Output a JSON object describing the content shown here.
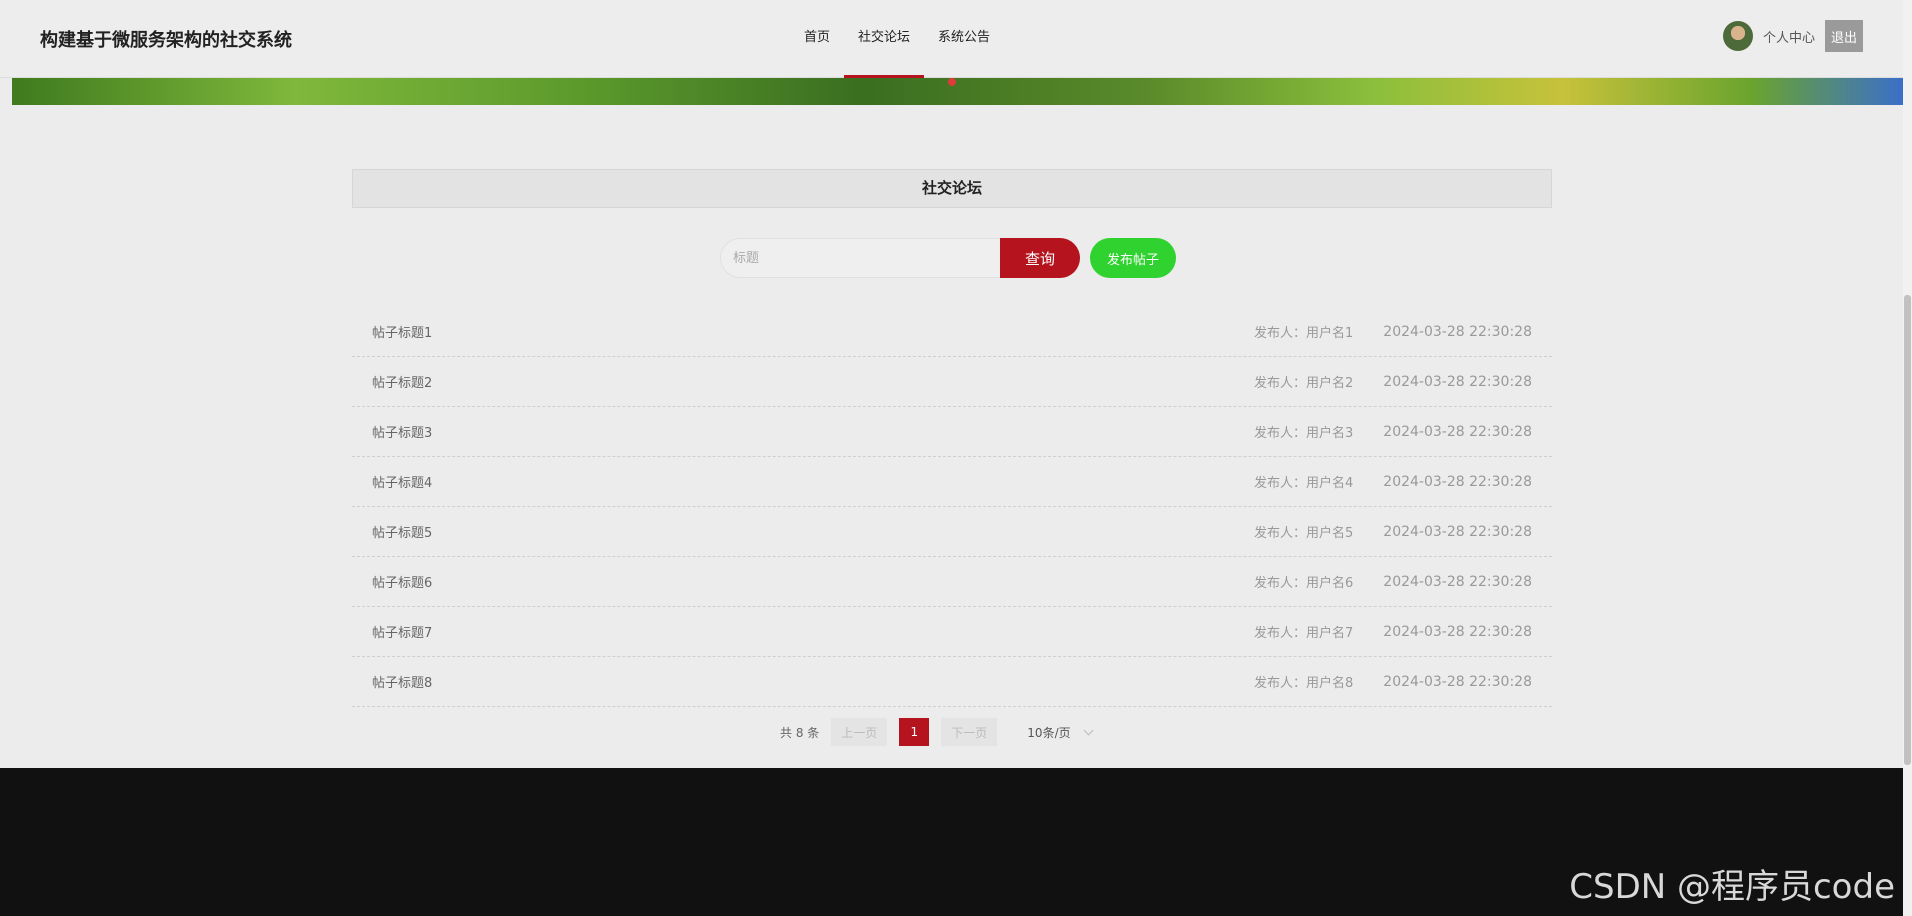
{
  "header": {
    "site_title": "构建基于微服务架构的社交系统",
    "nav": [
      {
        "label": "首页",
        "active": false
      },
      {
        "label": "社交论坛",
        "active": true
      },
      {
        "label": "系统公告",
        "active": false
      }
    ],
    "user_center": "个人中心",
    "logout": "退出"
  },
  "forum": {
    "title": "社交论坛",
    "search_placeholder": "标题",
    "search_button": "查询",
    "publish_button": "发布帖子",
    "posts": [
      {
        "title": "帖子标题1",
        "author": "发布人：用户名1",
        "time": "2024-03-28 22:30:28"
      },
      {
        "title": "帖子标题2",
        "author": "发布人：用户名2",
        "time": "2024-03-28 22:30:28"
      },
      {
        "title": "帖子标题3",
        "author": "发布人：用户名3",
        "time": "2024-03-28 22:30:28"
      },
      {
        "title": "帖子标题4",
        "author": "发布人：用户名4",
        "time": "2024-03-28 22:30:28"
      },
      {
        "title": "帖子标题5",
        "author": "发布人：用户名5",
        "time": "2024-03-28 22:30:28"
      },
      {
        "title": "帖子标题6",
        "author": "发布人：用户名6",
        "time": "2024-03-28 22:30:28"
      },
      {
        "title": "帖子标题7",
        "author": "发布人：用户名7",
        "time": "2024-03-28 22:30:28"
      },
      {
        "title": "帖子标题8",
        "author": "发布人：用户名8",
        "time": "2024-03-28 22:30:28"
      }
    ]
  },
  "pager": {
    "total": "共 8 条",
    "prev": "上一页",
    "current": "1",
    "next": "下一页",
    "page_size": "10条/页"
  },
  "watermark": "CSDN @程序员code",
  "colors": {
    "accent": "#b5141f",
    "publish": "#2fd22f",
    "footer": "#111111"
  }
}
